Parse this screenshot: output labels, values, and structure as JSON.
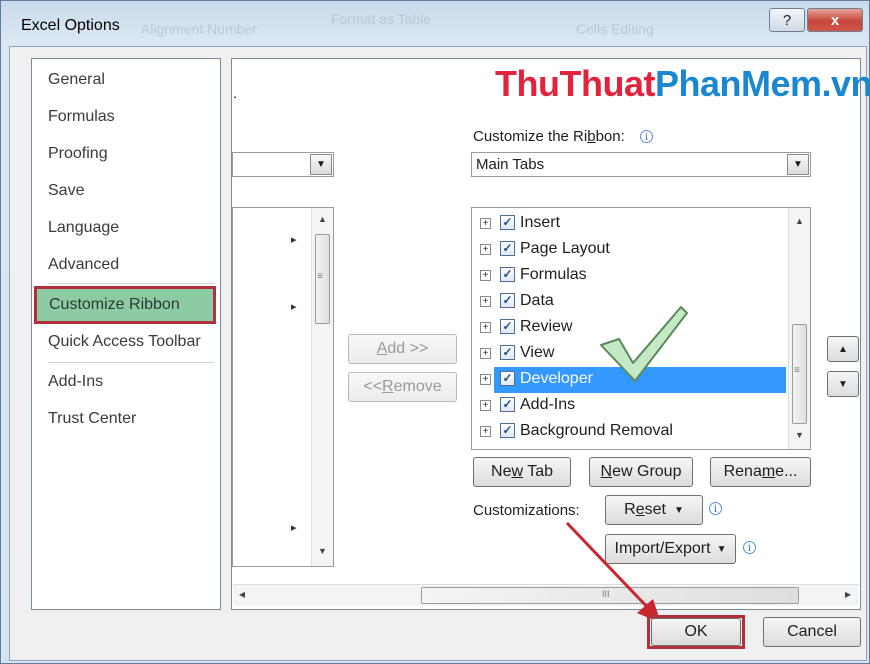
{
  "window": {
    "title": "Excel Options",
    "help_btn": "?",
    "close_btn": "x",
    "ghost_texts": [
      "Alignment   Number",
      "Format as Table",
      "Cells   Editing"
    ]
  },
  "nav": {
    "items": [
      {
        "label": "General"
      },
      {
        "label": "Formulas"
      },
      {
        "label": "Proofing"
      },
      {
        "label": "Save"
      },
      {
        "label": "Language"
      },
      {
        "label": "Advanced"
      },
      {
        "label": "Customize Ribbon",
        "selected": true
      },
      {
        "label": "Quick Access Toolbar"
      },
      {
        "label": "Add-Ins"
      },
      {
        "label": "Trust Center"
      }
    ]
  },
  "watermark": {
    "part1": "ThuThuat",
    "part2": "PhanMem",
    "part3": ".vn",
    "color1": "#e2233d",
    "color2": "#1a87cf"
  },
  "left_panel": {
    "dot": "."
  },
  "ribbon": {
    "label_prefix": "Customize the Ri",
    "label_underline": "b",
    "label_suffix": "bon:",
    "combo_value": "Main Tabs",
    "items": [
      {
        "label": "Insert",
        "checked": true
      },
      {
        "label": "Page Layout",
        "checked": true
      },
      {
        "label": "Formulas",
        "checked": true
      },
      {
        "label": "Data",
        "checked": true
      },
      {
        "label": "Review",
        "checked": true
      },
      {
        "label": "View",
        "checked": true
      },
      {
        "label": "Developer",
        "checked": true,
        "selected": true
      },
      {
        "label": "Add-Ins",
        "checked": true
      },
      {
        "label": "Background Removal",
        "checked": true
      }
    ]
  },
  "middle": {
    "add_u": "A",
    "add_rest": "dd >>",
    "remove_pre": "<< ",
    "remove_u": "R",
    "remove_rest": "emove"
  },
  "buttons": {
    "new_tab_pre": "Ne",
    "new_tab_u": "w",
    "new_tab_rest": " Tab",
    "new_group_u": "N",
    "new_group_rest": "ew Group",
    "rename_pre": "Rena",
    "rename_u": "m",
    "rename_rest": "e...",
    "customizations_label": "Customizations:",
    "reset_pre": "R",
    "reset_u": "e",
    "reset_rest": "set",
    "import_pre": "Import/Export",
    "ok": "OK",
    "cancel": "Cancel"
  },
  "scroll": {
    "arrow_up": "▲",
    "arrow_down": "▼",
    "arrow_left": "◂",
    "arrow_right": "▸",
    "grip": "≡",
    "hgrip": "III"
  },
  "colors": {
    "selection": "#3399ff",
    "highlight_border": "#b3303a",
    "nav_selected_bg": "#8ccba4"
  }
}
